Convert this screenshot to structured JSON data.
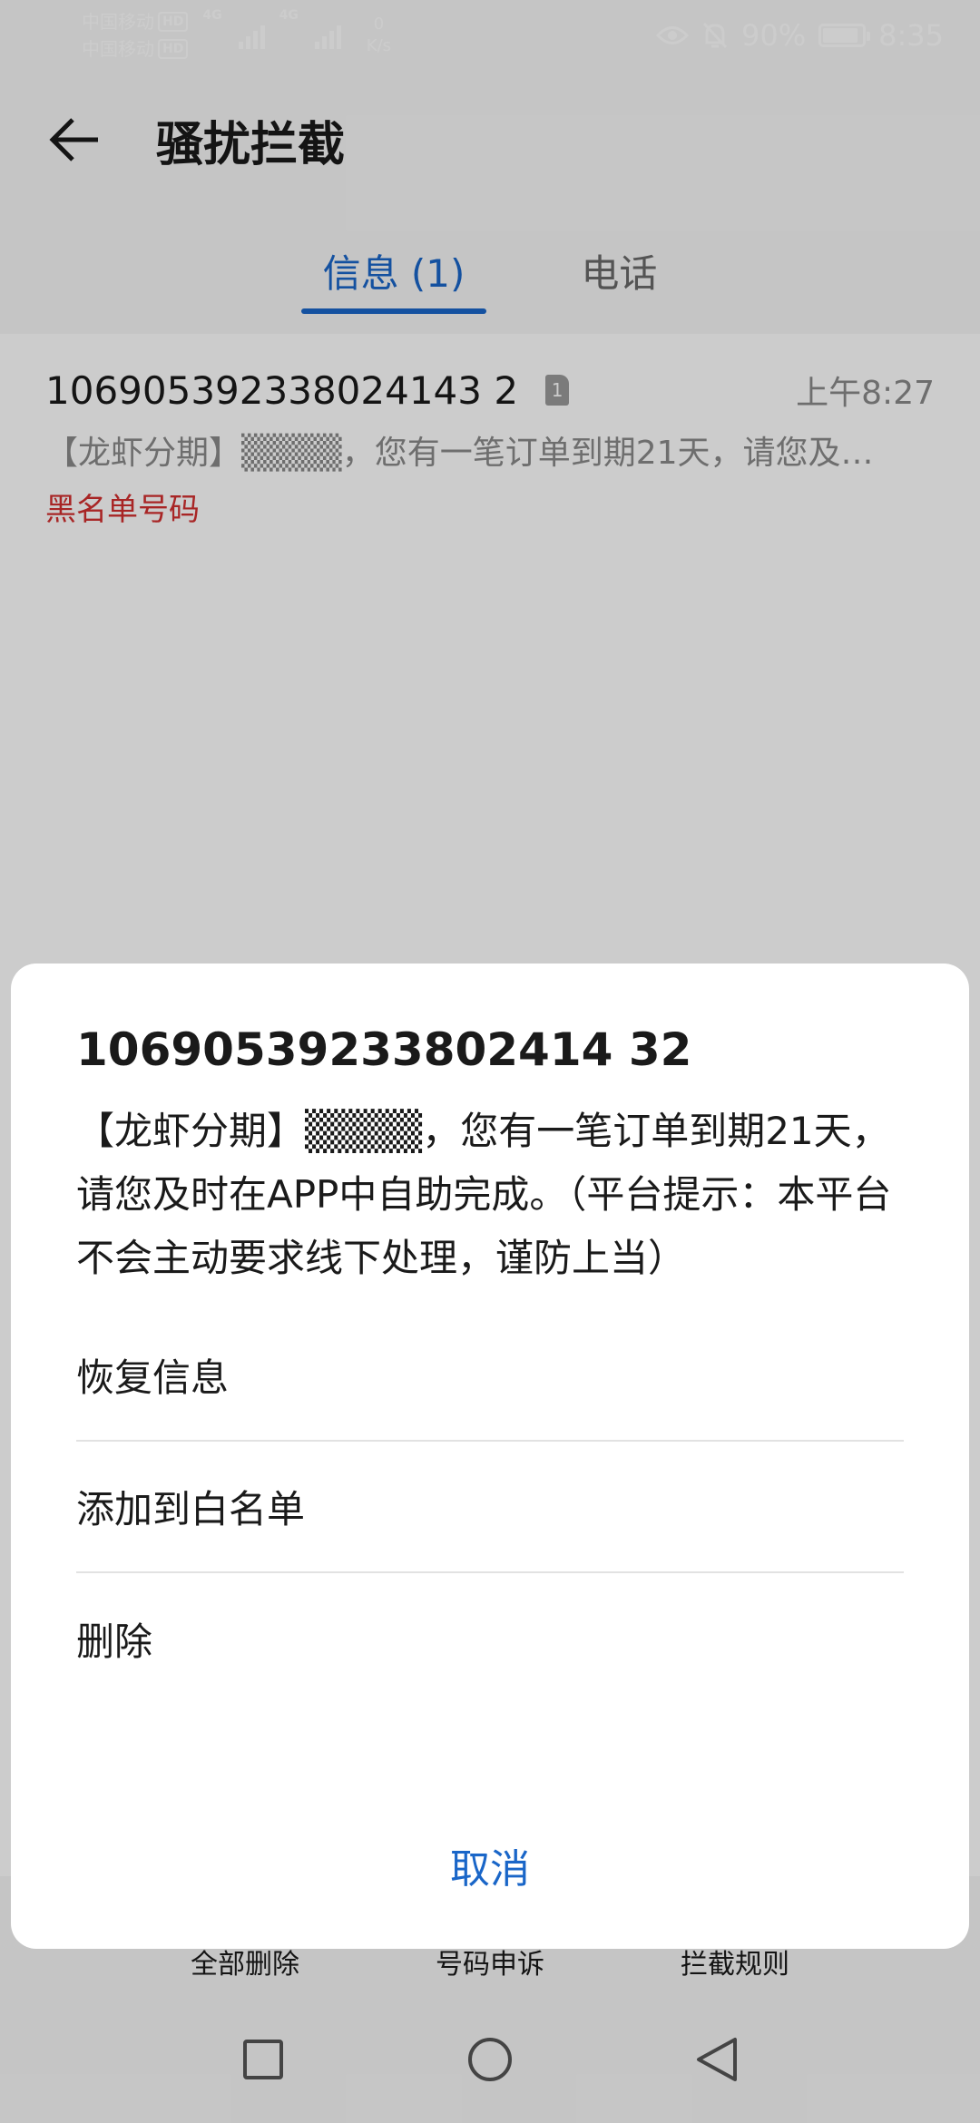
{
  "status_bar": {
    "carrier1": "中国移动",
    "carrier2": "中国移动",
    "hd": "HD",
    "network": "4G",
    "speed_value": "0",
    "speed_unit": "K/s",
    "battery": "90%",
    "time": "8:35"
  },
  "header": {
    "title": "骚扰拦截"
  },
  "tabs": [
    {
      "label": "信息 (1)",
      "active": true
    },
    {
      "label": "电话",
      "active": false
    }
  ],
  "messages": [
    {
      "number": "106905392338024143 2",
      "sim": "1",
      "time": "上午8:27",
      "preview": "【龙虾分期】▒▒▒▒，您有一笔订单到期21天，请您及…",
      "tag": "黑名单号码"
    }
  ],
  "bottom_bar": {
    "actions": [
      "全部删除",
      "号码申诉",
      "拦截规则"
    ]
  },
  "dialog": {
    "title": "10690539233802414 32",
    "message": "【龙虾分期】▒▒▒▒，您有一笔订单到期21天，请您及时在APP中自助完成。（平台提示：本平台不会主动要求线下处理，谨防上当）",
    "options": [
      "恢复信息",
      "添加到白名单",
      "删除"
    ],
    "cancel": "取消"
  },
  "colors": {
    "accent": "#1a66c8",
    "blacklist_tag": "#d32f2f"
  }
}
